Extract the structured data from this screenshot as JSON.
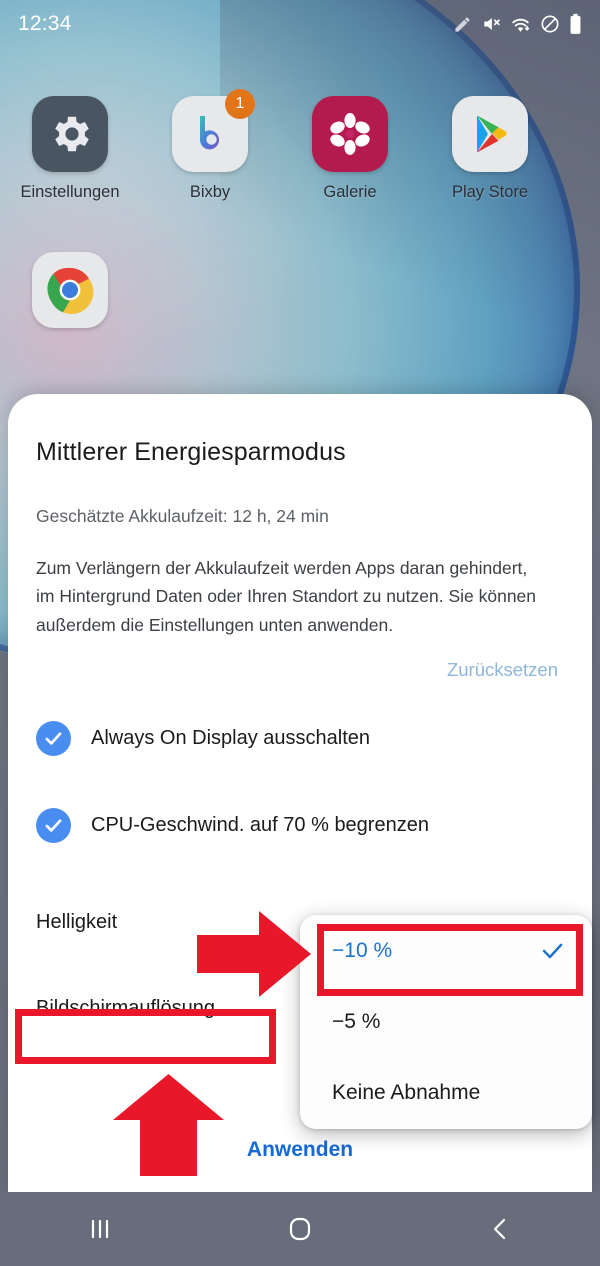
{
  "status_bar": {
    "time": "12:34",
    "icons": [
      "pencil-icon",
      "volume-muted-icon",
      "wifi-icon",
      "do-not-disturb-icon",
      "battery-icon"
    ]
  },
  "home_screen": {
    "apps": [
      {
        "label": "Einstellungen",
        "icon": "settings-gear-icon",
        "badge": ""
      },
      {
        "label": "Bixby",
        "icon": "bixby-icon",
        "badge": "1"
      },
      {
        "label": "Galerie",
        "icon": "gallery-flower-icon",
        "badge": ""
      },
      {
        "label": "Play Store",
        "icon": "play-store-icon",
        "badge": ""
      },
      {
        "label": "",
        "icon": "chrome-icon",
        "badge": ""
      }
    ]
  },
  "sheet": {
    "title": "Mittlerer Energiesparmodus",
    "subtitle": "Geschätzte Akkulaufzeit: 12 h, 24 min",
    "body": "Zum Verlängern der Akkulaufzeit werden Apps daran gehindert, im Hintergrund Daten oder Ihren Standort zu nutzen. Sie können außerdem die Einstellungen unten anwenden.",
    "reset_label": "Zurücksetzen",
    "checkboxes": [
      {
        "label": "Always On Display ausschalten",
        "checked": true
      },
      {
        "label": "CPU-Geschwind. auf 70 % begrenzen",
        "checked": true
      }
    ],
    "settings": [
      {
        "label": "Helligkeit"
      },
      {
        "label": "Bildschirmauflösung"
      }
    ],
    "apply_label": "Anwenden"
  },
  "dropdown": {
    "options": [
      {
        "label": "−10 %",
        "selected": true
      },
      {
        "label": "−5 %",
        "selected": false
      },
      {
        "label": "Keine Abnahme",
        "selected": false
      }
    ]
  },
  "navigation_bar": {
    "recents": "recents-icon",
    "home": "home-icon",
    "back": "back-icon"
  },
  "annotations": {
    "color": "#e8182a",
    "items": [
      {
        "name": "arrow-right-to-dropdown",
        "type": "arrow-right"
      },
      {
        "name": "box-around-selected-option",
        "type": "box"
      },
      {
        "name": "box-around-resolution-label",
        "type": "box"
      },
      {
        "name": "arrow-up-to-resolution",
        "type": "arrow-up"
      }
    ]
  },
  "colors": {
    "accent_blue": "#4a8df0",
    "link_blue": "#1669d6",
    "selected_blue": "#1a73c8",
    "disabled_link": "#8fb6de",
    "annotation_red": "#e8182a",
    "badge_orange": "#e2751a"
  }
}
